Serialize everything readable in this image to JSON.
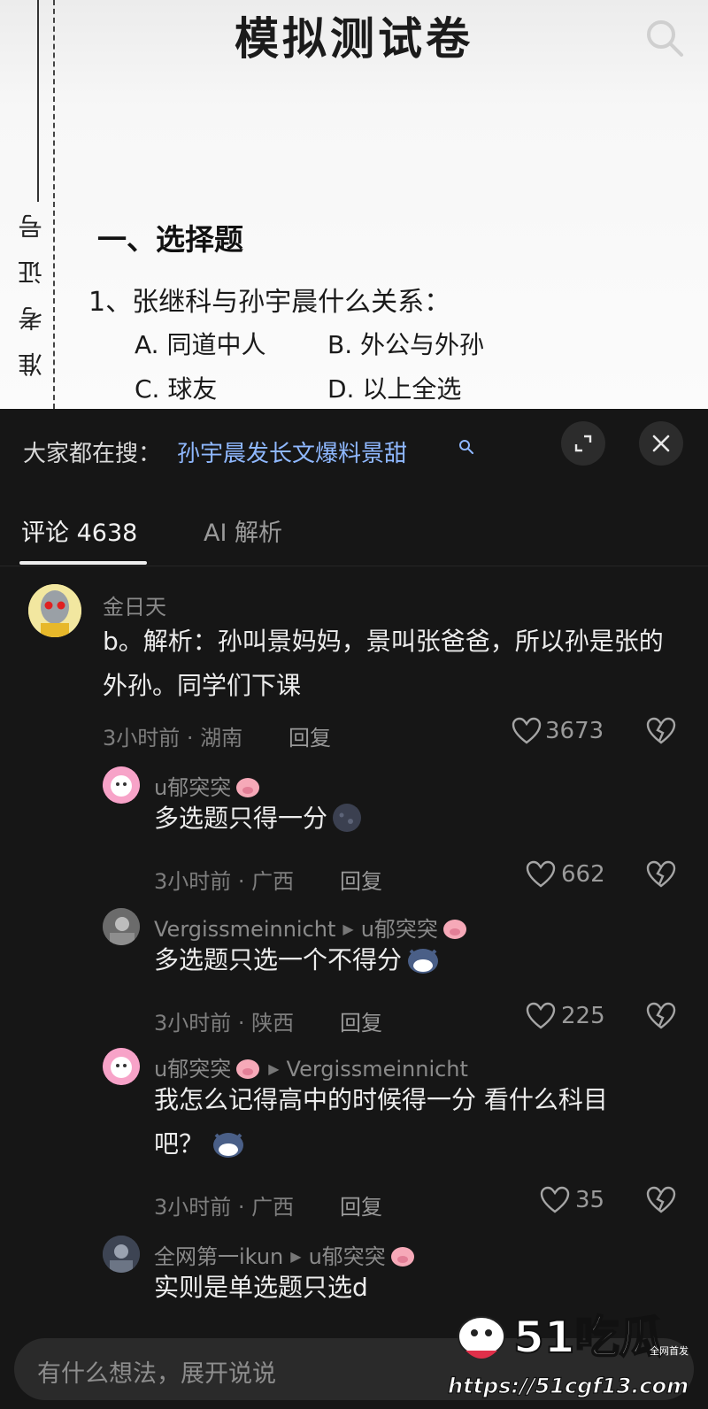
{
  "paper": {
    "title": "模拟测试卷",
    "vertical_label": "准考证号",
    "section_heading": "一、选择题",
    "question": "1、张继科与孙宇晨什么关系：",
    "options": [
      "A. 同道中人",
      "B. 外公与外孙",
      "C. 球友",
      "D. 以上全选"
    ]
  },
  "search": {
    "prefix": "大家都在搜：",
    "query": "孙宇晨发长文爆料景甜"
  },
  "tabs": {
    "comments": "评论 4638",
    "ai": "AI 解析"
  },
  "comments": [
    {
      "name": "金日天",
      "text": "b。解析：孙叫景妈妈，景叫张爸爸，所以孙是张的外孙。同学们下课",
      "meta": "3小时前 · 湖南",
      "reply": "回复",
      "likes": "3673"
    },
    {
      "name": "u郁突突",
      "text": "多选题只得一分",
      "meta": "3小时前 · 广西",
      "reply": "回复",
      "likes": "662"
    },
    {
      "name": "Vergissmeinnicht",
      "reply_to": "u郁突突",
      "text": "多选题只选一个不得分",
      "meta": "3小时前 · 陕西",
      "reply": "回复",
      "likes": "225"
    },
    {
      "name": "u郁突突",
      "reply_to": "Vergissmeinnicht",
      "text": "我怎么记得高中的时候得一分 看什么科目吧？",
      "meta": "3小时前 · 广西",
      "reply": "回复",
      "likes": "35"
    },
    {
      "name": "全网第一ikun",
      "reply_to": "u郁突突",
      "text": "实则是单选题只选d"
    }
  ],
  "input": {
    "placeholder": "有什么想法，展开说说"
  },
  "watermark": {
    "brand": "51吃瓜",
    "tag": "全网首发",
    "url": "https://51cgf13.com"
  },
  "colors": {
    "link": "#8fb8ff",
    "background": "#161616",
    "paper": "#f7f7f7"
  }
}
